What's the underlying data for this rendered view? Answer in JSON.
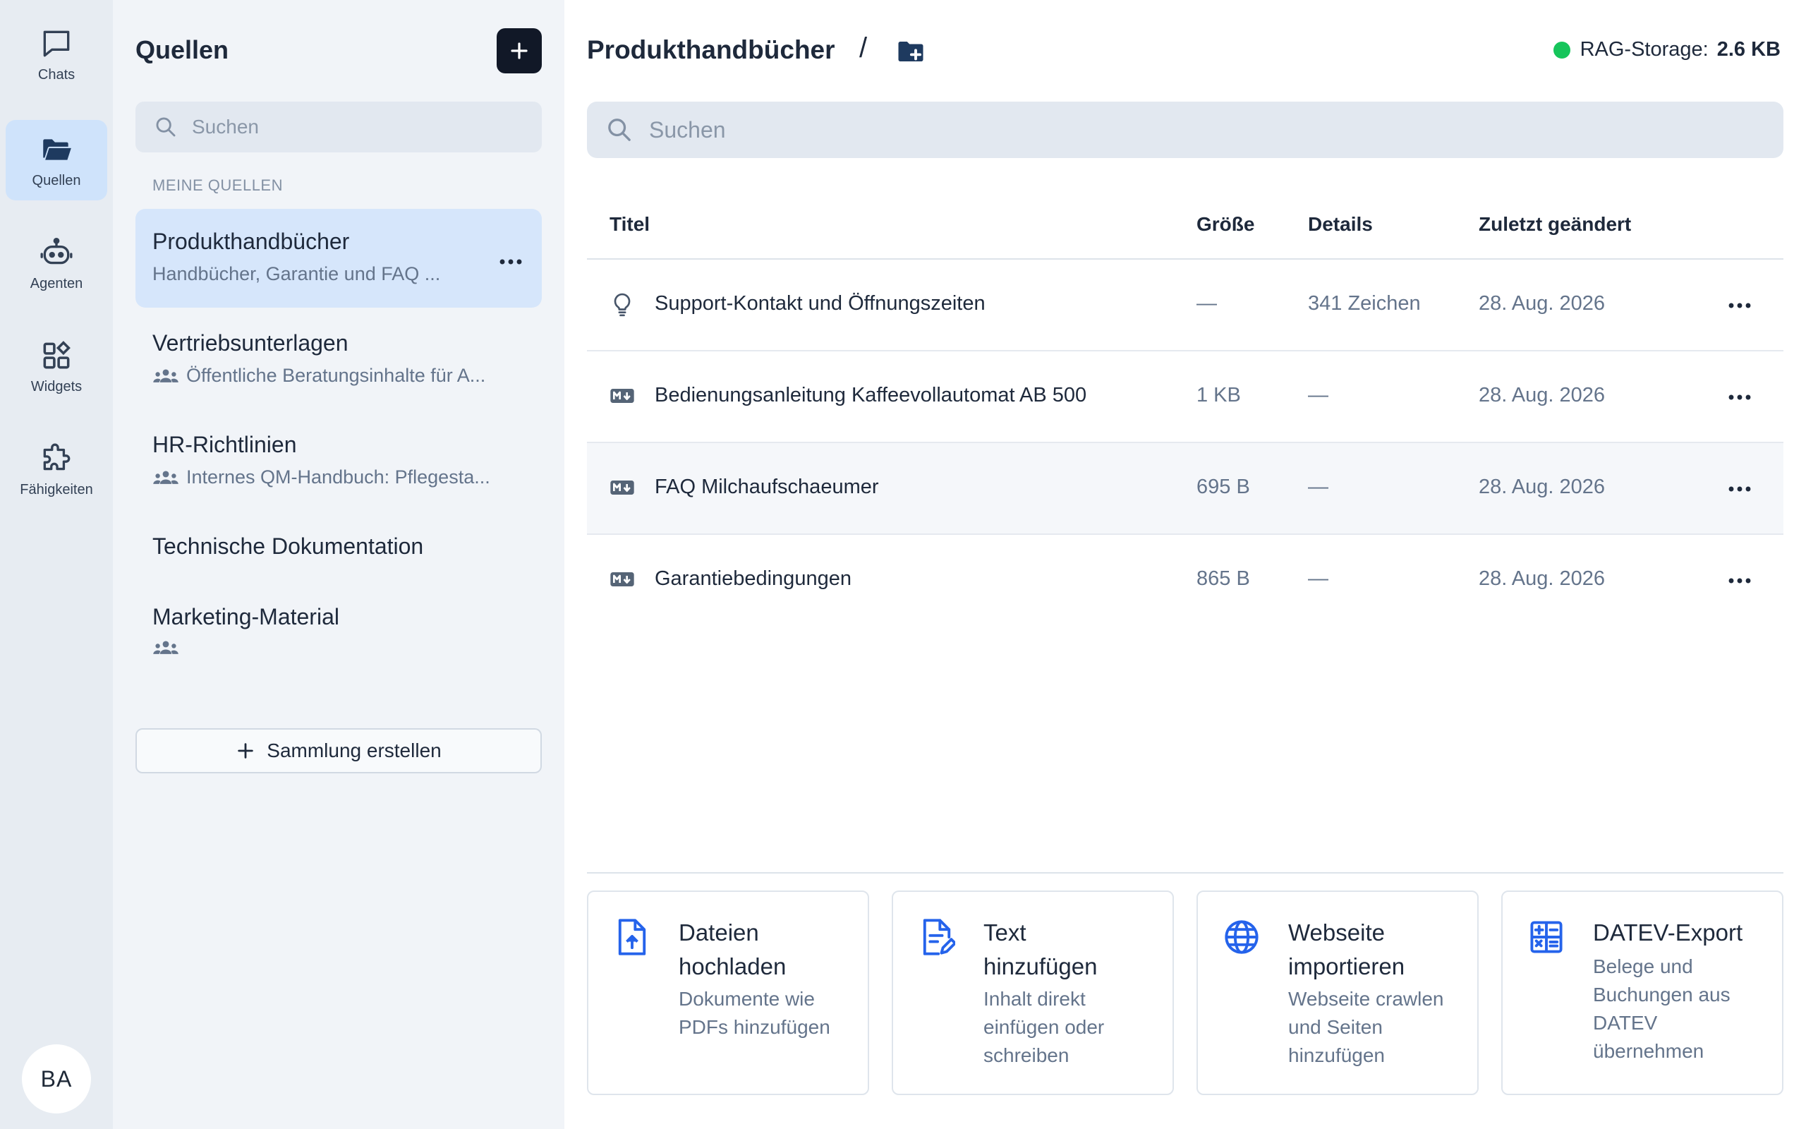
{
  "rail": {
    "items": [
      {
        "label": "Chats",
        "icon": "chat-bubble-icon"
      },
      {
        "label": "Quellen",
        "icon": "folder-open-icon",
        "active": true
      },
      {
        "label": "Agenten",
        "icon": "robot-icon"
      },
      {
        "label": "Widgets",
        "icon": "widgets-icon"
      },
      {
        "label": "Fähigkeiten",
        "icon": "puzzle-icon"
      }
    ],
    "avatar": "BA"
  },
  "sources": {
    "title": "Quellen",
    "search_placeholder": "Suchen",
    "section_label": "MEINE QUELLEN",
    "collections": [
      {
        "name": "Produkthandbücher",
        "description": "Handbücher, Garantie und FAQ ...",
        "shared": false,
        "active": true
      },
      {
        "name": "Vertriebsunterlagen",
        "description": "Öffentliche Beratungsinhalte für A...",
        "shared": true
      },
      {
        "name": "HR-Richtlinien",
        "description": "Internes QM-Handbuch: Pflegesta...",
        "shared": true
      },
      {
        "name": "Technische Dokumentation",
        "description": "",
        "shared": false
      },
      {
        "name": "Marketing-Material",
        "description": "",
        "shared": true
      }
    ],
    "create_label": "Sammlung erstellen"
  },
  "main": {
    "breadcrumb_title": "Produkthandbücher",
    "breadcrumb_sep": "/",
    "storage_label": "RAG-Storage:",
    "storage_value": "2.6 KB",
    "search_placeholder": "Suchen",
    "columns": [
      "Titel",
      "Größe",
      "Details",
      "Zuletzt geändert"
    ],
    "rows": [
      {
        "icon": "lightbulb-icon",
        "title": "Support-Kontakt und Öffnungszeiten",
        "size": "—",
        "details": "341 Zeichen",
        "modified": "28. Aug. 2026"
      },
      {
        "icon": "markdown-icon",
        "title": "Bedienungsanleitung Kaffeevollautomat AB 500",
        "size": "1 KB",
        "details": "—",
        "modified": "28. Aug. 2026"
      },
      {
        "icon": "markdown-icon",
        "title": "FAQ Milchaufschaeumer",
        "size": "695 B",
        "details": "—",
        "modified": "28. Aug. 2026"
      },
      {
        "icon": "markdown-icon",
        "title": "Garantiebedingungen",
        "size": "865 B",
        "details": "—",
        "modified": "28. Aug. 2026"
      }
    ],
    "cards": [
      {
        "title_line1": "Dateien",
        "title_line2": "hochladen",
        "desc": [
          "Dokumente wie",
          "PDFs hinzufügen"
        ],
        "icon": "file-upload-icon"
      },
      {
        "title_line1": "Text",
        "title_line2": "hinzufügen",
        "desc": [
          "Inhalt direkt",
          "einfügen oder",
          "schreiben"
        ],
        "icon": "file-edit-icon"
      },
      {
        "title_line1": "Webseite",
        "title_line2": "importieren",
        "desc": [
          "Webseite crawlen",
          "und Seiten",
          "hinzufügen"
        ],
        "icon": "globe-icon"
      },
      {
        "title_line1": "DATEV-Export",
        "title_line2": "",
        "desc": [
          "Belege und",
          "Buchungen aus",
          "DATEV",
          "übernehmen"
        ],
        "icon": "calculator-icon"
      }
    ],
    "accent_color": "#2563eb"
  }
}
